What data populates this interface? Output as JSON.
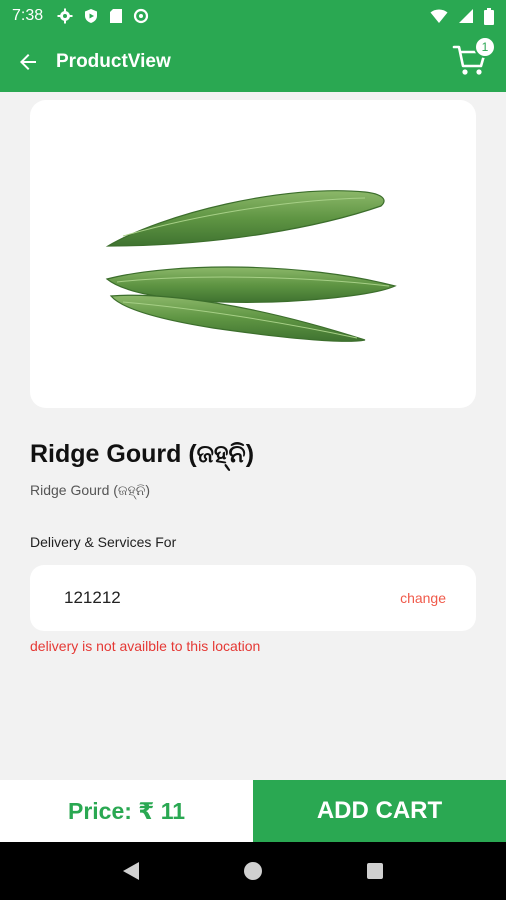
{
  "status_bar": {
    "time": "7:38"
  },
  "app_bar": {
    "title": "ProductView",
    "cart_count": "1"
  },
  "product": {
    "title": "Ridge Gourd (ଜହ୍ନି)",
    "subtitle": "Ridge Gourd (ଜହ୍ନି)"
  },
  "delivery": {
    "label": "Delivery & Services For",
    "pincode": "121212",
    "change_label": "change",
    "error": "delivery is not availble to this location"
  },
  "bottom_bar": {
    "price": "Price: ₹ 11",
    "add_cart_label": "ADD CART"
  },
  "colors": {
    "primary": "#2aa852",
    "error": "#e53935",
    "change": "#f05a4a"
  }
}
